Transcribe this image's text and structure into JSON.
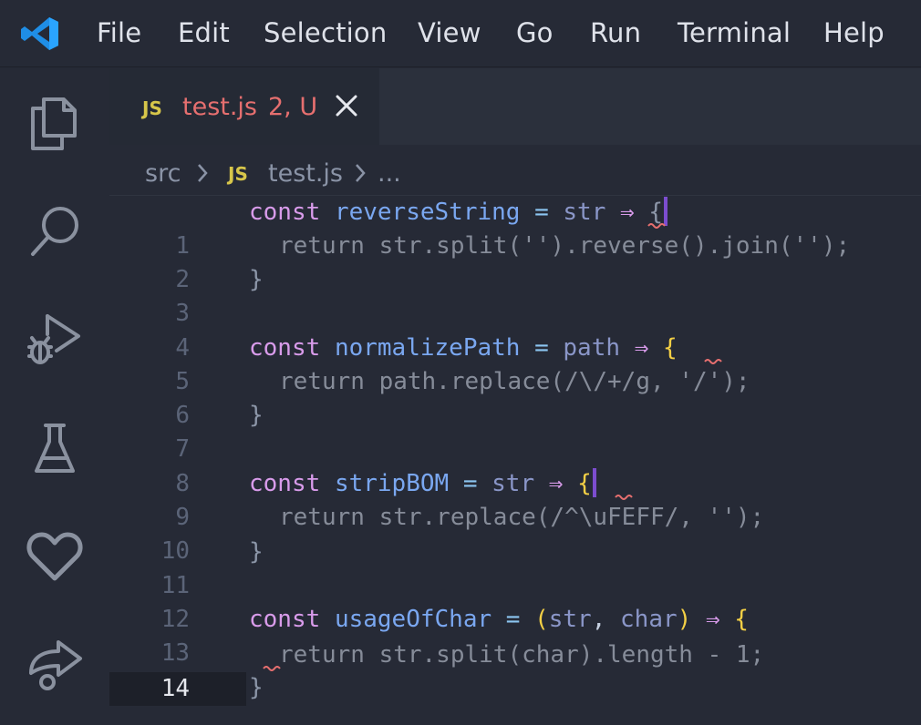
{
  "menu": [
    "File",
    "Edit",
    "Selection",
    "View",
    "Go",
    "Run",
    "Terminal",
    "Help"
  ],
  "activity_bar": [
    "files-icon",
    "search-icon",
    "run-debug-icon",
    "testing-icon",
    "heart-icon",
    "remote-share-icon"
  ],
  "tab": {
    "badge": "JS",
    "filename": "test.js",
    "status": "2, U"
  },
  "breadcrumb": {
    "folder": "src",
    "badge": "JS",
    "file": "test.js",
    "more": "..."
  },
  "code": {
    "line_numbers": [
      "1",
      "2",
      "3",
      "4",
      "5",
      "6",
      "7",
      "8",
      "9",
      "10",
      "11",
      "12",
      "13",
      "14"
    ],
    "current_line": 14,
    "l1": {
      "kw": "const",
      "name": "reverseString",
      "eq": "=",
      "param": "str",
      "arrow": "⇒",
      "brace": "{"
    },
    "l2": "return str.split('').reverse().join('');",
    "l3": "}",
    "l5": {
      "kw": "const",
      "name": "normalizePath",
      "eq": "=",
      "param": "path",
      "arrow": "⇒",
      "brace": "{"
    },
    "l6": "return path.replace(/\\/+/g, '/');",
    "l7": "}",
    "l9": {
      "kw": "const",
      "name": "stripBOM",
      "eq": "=",
      "param": "str",
      "arrow": "⇒",
      "brace": "{"
    },
    "l10": "return str.replace(/^\\uFEFF/, '');",
    "l11": "}",
    "l13": {
      "kw": "const",
      "name": "usageOfChar",
      "eq": "=",
      "open": "(",
      "p1": "str",
      "comma": ",",
      "p2": "char",
      "close": ")",
      "arrow": "⇒",
      "brace": "{"
    },
    "l14": "return str.split(char).length - 1;",
    "l15": "}"
  },
  "colors": {
    "keyword": "#d89bea",
    "function": "#7aa7f0",
    "operator": "#8cc6f2",
    "parameter": "#8a96c8",
    "bracket": "#f3cf45",
    "error": "#e66f6f",
    "js_badge": "#d7c64a"
  }
}
